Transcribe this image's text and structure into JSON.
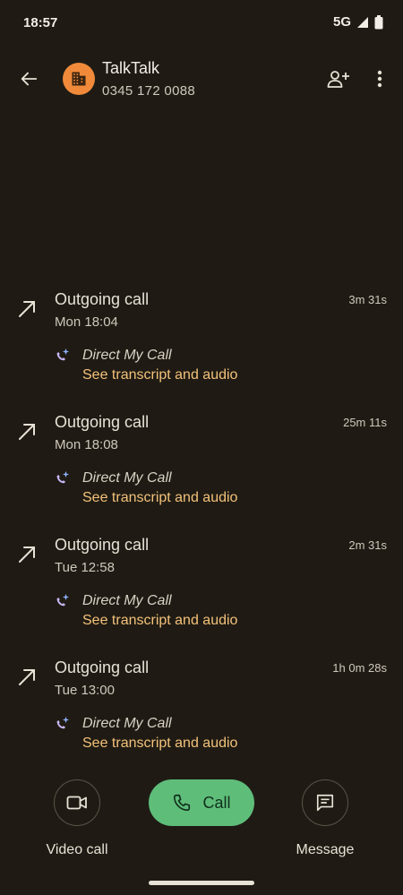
{
  "status": {
    "time": "18:57",
    "network": "5G"
  },
  "header": {
    "name": "TalkTalk",
    "number": "0345 172 0088"
  },
  "calls": [
    {
      "type": "Outgoing call",
      "time": "Mon 18:04",
      "duration": "3m 31s",
      "assistant": "Direct My Call",
      "link": "See transcript and audio"
    },
    {
      "type": "Outgoing call",
      "time": "Mon 18:08",
      "duration": "25m 11s",
      "assistant": "Direct My Call",
      "link": "See transcript and audio"
    },
    {
      "type": "Outgoing call",
      "time": "Tue 12:58",
      "duration": "2m 31s",
      "assistant": "Direct My Call",
      "link": "See transcript and audio"
    },
    {
      "type": "Outgoing call",
      "time": "Tue 13:00",
      "duration": "1h 0m 28s",
      "assistant": "Direct My Call",
      "link": "See transcript and audio"
    }
  ],
  "actions": {
    "video_label": "Video call",
    "call_label": "Call",
    "message_label": "Message"
  },
  "icons": {
    "back": "arrow-back-icon",
    "avatar": "business-building-icon",
    "add_contact": "add-person-icon",
    "more": "more-vert-icon",
    "outgoing": "outgoing-arrow-icon",
    "direct_my_call": "sparkle-phone-icon",
    "video": "videocam-icon",
    "phone": "phone-icon",
    "message": "chat-bubble-icon"
  },
  "colors": {
    "background": "#1f1b14",
    "accent_link": "#f4c27a",
    "avatar": "#f08a3a",
    "call_button": "#5fbd7a"
  }
}
